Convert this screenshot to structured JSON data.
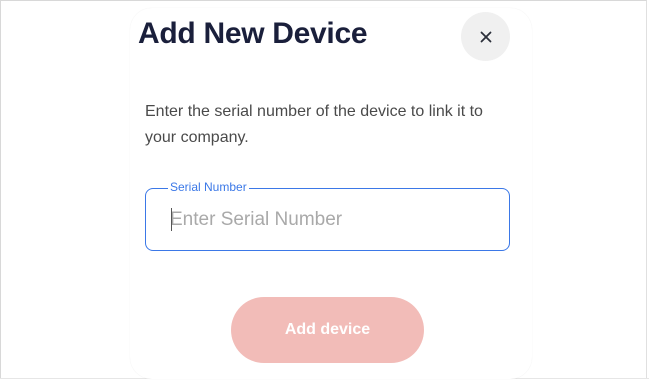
{
  "dialog": {
    "title": "Add New Device",
    "close_icon": "close-icon",
    "description": "Enter the serial number of the device to link it to your company.",
    "serial_field": {
      "label": "Serial Number",
      "value": "",
      "placeholder": "Enter Serial Number"
    },
    "submit_label": "Add device"
  },
  "colors": {
    "title": "#1a1f3b",
    "accent": "#3b78e7",
    "button_disabled": "#f2bcb8",
    "close_bg": "#f0f0f0"
  }
}
